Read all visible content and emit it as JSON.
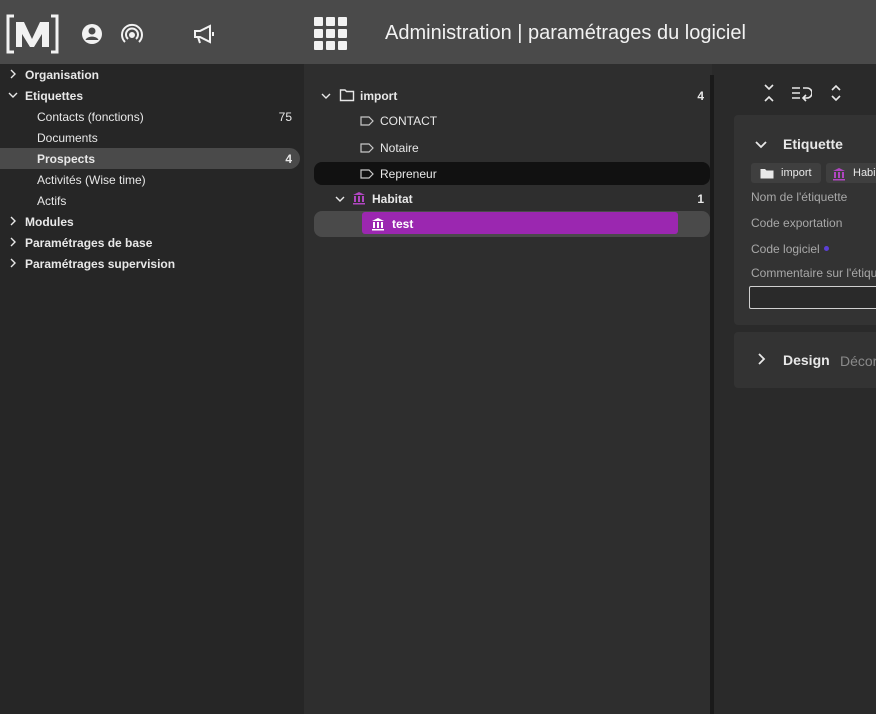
{
  "header": {
    "title": "Administration | paramétrages du logiciel",
    "icons": [
      "logo-icon",
      "account-icon",
      "broadcast-icon",
      "megaphone-icon",
      "apps-grid-icon"
    ]
  },
  "sidebar": {
    "items": [
      {
        "label": "Organisation",
        "level": 1,
        "expanded": false
      },
      {
        "label": "Etiquettes",
        "level": 1,
        "expanded": true
      },
      {
        "label": "Contacts (fonctions)",
        "level": 2,
        "count": "75"
      },
      {
        "label": "Documents",
        "level": 2
      },
      {
        "label": "Prospects",
        "level": 2,
        "count": "4",
        "selected": true
      },
      {
        "label": "Activités (Wise time)",
        "level": 2
      },
      {
        "label": "Actifs",
        "level": 2
      },
      {
        "label": "Modules",
        "level": 1,
        "expanded": false
      },
      {
        "label": "Paramétrages de base",
        "level": 1,
        "expanded": false
      },
      {
        "label": "Paramétrages supervision",
        "level": 1,
        "expanded": false
      }
    ]
  },
  "tree": {
    "folder": {
      "label": "import",
      "count": "4"
    },
    "tags": [
      {
        "label": "CONTACT"
      },
      {
        "label": "Notaire"
      },
      {
        "label": "Repreneur"
      }
    ],
    "group": {
      "label": "Habitat",
      "count": "1"
    },
    "selected": {
      "label": "test"
    }
  },
  "detail": {
    "toolbar_icons": [
      "collapse-all-icon",
      "wrap-text-icon",
      "expand-all-icon"
    ],
    "card_title": "Etiquette",
    "chips": [
      {
        "label": "import",
        "icon": "folder-icon"
      },
      {
        "label": "Habi",
        "icon": "institution-icon"
      }
    ],
    "fields": [
      "Nom de l'étiquette",
      "Code exportation",
      "Code logiciel",
      "Commentaire sur l'étiqu"
    ],
    "design_title": "Design",
    "design_subtitle": "Décor"
  },
  "colors": {
    "accent": "#9b27b0",
    "topbar": "#4a4a4a",
    "dot": "#5b3fd6"
  }
}
